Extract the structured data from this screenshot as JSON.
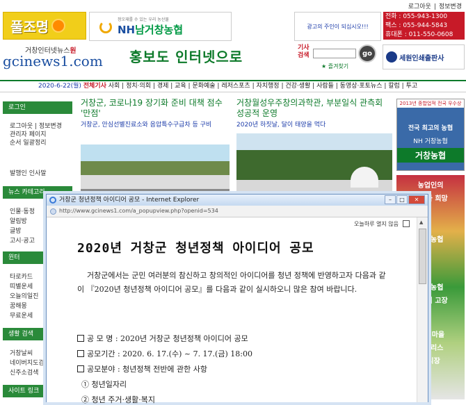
{
  "header": {
    "top_links": [
      "로그아웃",
      "정보변경"
    ],
    "logo_text": "풀조명",
    "nh_slogan": "정오재를 수 있는 우리 농산물",
    "nh_name_nh": "NH",
    "nh_name_rest": "남거창농협",
    "ad_text": "광고의 주인이 되십시오!!!",
    "contact": [
      "전화 : 055-943-1300",
      "팩스 : 055-944-5843",
      "휴대폰 : 011-550-0608"
    ],
    "brand_small_pre": "거창인터넷뉴스",
    "brand_small_accent": "원",
    "brand_big": "gcinews1.com",
    "promo": "홍보도 인터넷으로",
    "search_label": "기사\n검색",
    "search_button": "go",
    "favorites": "즐겨찾기",
    "print_ad": "세원인쇄출판사"
  },
  "navbar": {
    "date": "2020-6-22(월)",
    "hot": "전체기사",
    "items": "사회 | 정치·의회 | 경제 | 교육 | 문화예술 | 레저스포츠 | 자치행정 | 건강·생활 | 사람들 | 동영상·포토뉴스 | 칼럼 | 투고"
  },
  "sidebar": {
    "login_head": "로그인",
    "login_links": [
      "로그아웃 | 정보변경",
      "관리자 페이지",
      "순서 일괄정리"
    ],
    "issuer": "발행인 인사말",
    "category_head": "뉴스 카테고리",
    "categories": [
      "인물·동정",
      "알림방",
      "글방",
      "고시·공고"
    ],
    "fortune_head": "윈터",
    "fortune": [
      "타로카드",
      "띠별운세",
      "오늘의일진",
      "꿈해몽",
      "무료운세"
    ],
    "life_head": "생활 검색",
    "life": [
      "거창날씨",
      "네이버지도검색",
      "신주소검색"
    ],
    "site_head": "사이트 링크"
  },
  "articles": [
    {
      "title": "거창군, 코로나19 장기화 준비 대책 점수 '만점'",
      "sub": "거창군, 안심선별진료소와 음압특수구급차 등 구비"
    },
    {
      "title": "거창월성우주창의과학관, 부분일식 관측회 성공적 운영",
      "sub": "2020년 하짓날, 달이 태양을 먹다"
    }
  ],
  "right_ads": {
    "ad1_lines": [
      "2013년 종합업적 전국 우수상",
      "전국 최고의 농협",
      "NH 거창농협",
      "거창농협"
    ],
    "ad2_lines": [
      "농업인의",
      "소득과 희망",
      "북부농협",
      "거창농협",
      "농업의 고장",
      "우리 마을",
      "우팔리스",
      "축시장"
    ]
  },
  "popup": {
    "window_title": "거창군 청년정책 아이디어 공모 - Internet Explorer",
    "url": "http://www.gcinews1.com/a_popupview.php?openid=534",
    "today_close": "오늘하루 열지 않음",
    "doc_title": "2020년 거창군 청년정책 아이디어 공모",
    "paragraph": "거창군에서는 군민 여러분의 참신하고 창의적인 아이디어를 청년 정책에 반영하고자 다음과 같이 『2020년 청년정책 아이디어 공모』를 다음과 같이 실시하오니 많은 참여 바랍니다.",
    "bullets": [
      "공 모 명 : 2020년 거창군 청년정책 아이디어 공모",
      "공모기간 : 2020. 6. 17.(수) ~ 7. 17.(금) 18:00",
      "공모분야 : 청년정책 전반에 관한 사항"
    ],
    "numbered": [
      "① 청년일자리",
      "② 청년 주거·생활·복지"
    ]
  }
}
